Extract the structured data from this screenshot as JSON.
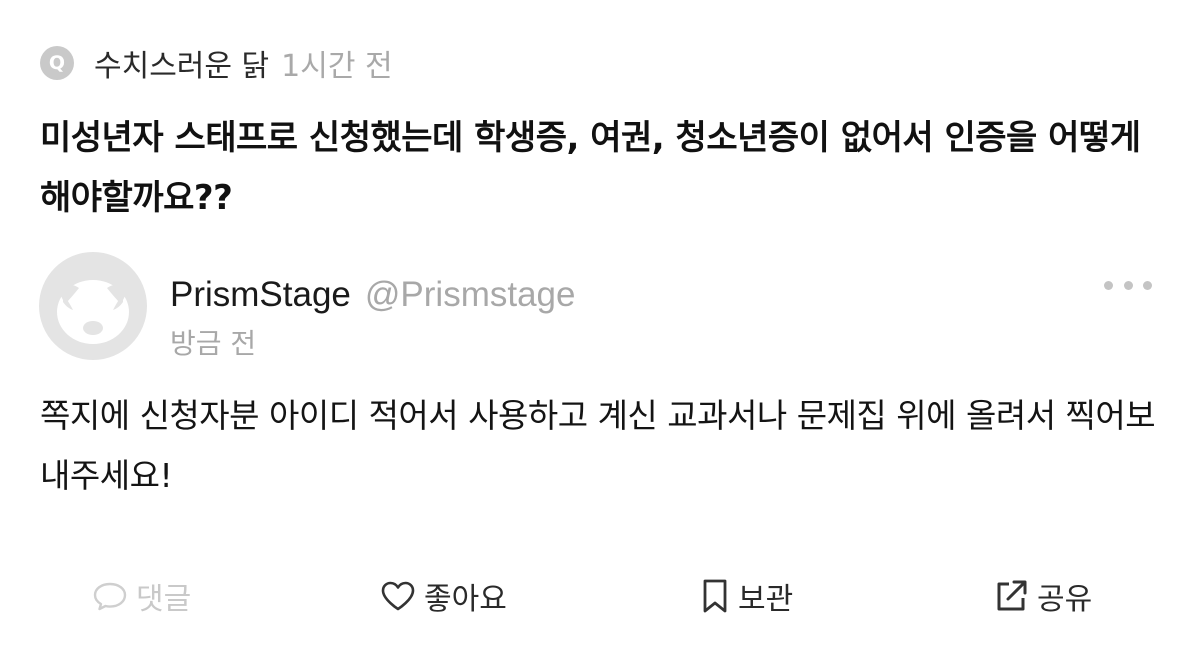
{
  "question": {
    "badge": "Q",
    "author": "수치스러운 닭",
    "time": "1시간 전",
    "text": "미성년자 스태프로 신청했는데 학생증, 여권, 청소년증이 없어서 인증을 어떻게 해야할까요??"
  },
  "answer": {
    "name": "PrismStage",
    "handle": "@Prismstage",
    "time": "방금 전",
    "text": "쪽지에 신청자분 아이디 적어서 사용하고 계신 교과서나 문제집 위에 올려서 찍어보내주세요!"
  },
  "actions": {
    "comment": "댓글",
    "like": "좋아요",
    "save": "보관",
    "share": "공유"
  },
  "icons": {
    "more": "more-dots-icon",
    "comment": "speech-bubble-icon",
    "like": "heart-outline-icon",
    "save": "bookmark-outline-icon",
    "share": "share-arrow-icon"
  },
  "colors": {
    "muted_text": "#a8a8a8",
    "disabled_text": "#c9c9c9",
    "badge_bg": "#c9c9c9",
    "avatar_bg": "#e4e4e4"
  }
}
